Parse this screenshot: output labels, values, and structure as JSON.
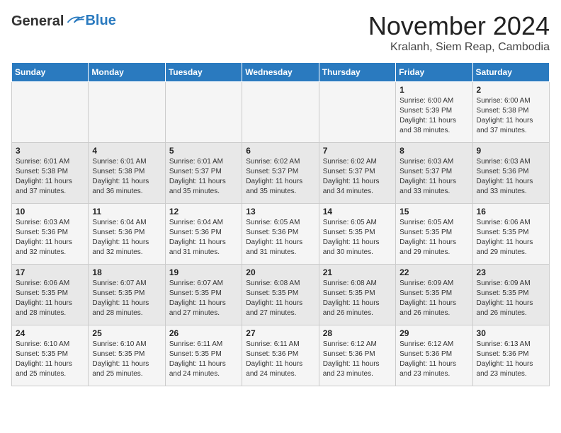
{
  "header": {
    "logo_general": "General",
    "logo_blue": "Blue",
    "month": "November 2024",
    "location": "Kralanh, Siem Reap, Cambodia"
  },
  "weekdays": [
    "Sunday",
    "Monday",
    "Tuesday",
    "Wednesday",
    "Thursday",
    "Friday",
    "Saturday"
  ],
  "weeks": [
    [
      {
        "day": "",
        "info": ""
      },
      {
        "day": "",
        "info": ""
      },
      {
        "day": "",
        "info": ""
      },
      {
        "day": "",
        "info": ""
      },
      {
        "day": "",
        "info": ""
      },
      {
        "day": "1",
        "info": "Sunrise: 6:00 AM\nSunset: 5:39 PM\nDaylight: 11 hours\nand 38 minutes."
      },
      {
        "day": "2",
        "info": "Sunrise: 6:00 AM\nSunset: 5:38 PM\nDaylight: 11 hours\nand 37 minutes."
      }
    ],
    [
      {
        "day": "3",
        "info": "Sunrise: 6:01 AM\nSunset: 5:38 PM\nDaylight: 11 hours\nand 37 minutes."
      },
      {
        "day": "4",
        "info": "Sunrise: 6:01 AM\nSunset: 5:38 PM\nDaylight: 11 hours\nand 36 minutes."
      },
      {
        "day": "5",
        "info": "Sunrise: 6:01 AM\nSunset: 5:37 PM\nDaylight: 11 hours\nand 35 minutes."
      },
      {
        "day": "6",
        "info": "Sunrise: 6:02 AM\nSunset: 5:37 PM\nDaylight: 11 hours\nand 35 minutes."
      },
      {
        "day": "7",
        "info": "Sunrise: 6:02 AM\nSunset: 5:37 PM\nDaylight: 11 hours\nand 34 minutes."
      },
      {
        "day": "8",
        "info": "Sunrise: 6:03 AM\nSunset: 5:37 PM\nDaylight: 11 hours\nand 33 minutes."
      },
      {
        "day": "9",
        "info": "Sunrise: 6:03 AM\nSunset: 5:36 PM\nDaylight: 11 hours\nand 33 minutes."
      }
    ],
    [
      {
        "day": "10",
        "info": "Sunrise: 6:03 AM\nSunset: 5:36 PM\nDaylight: 11 hours\nand 32 minutes."
      },
      {
        "day": "11",
        "info": "Sunrise: 6:04 AM\nSunset: 5:36 PM\nDaylight: 11 hours\nand 32 minutes."
      },
      {
        "day": "12",
        "info": "Sunrise: 6:04 AM\nSunset: 5:36 PM\nDaylight: 11 hours\nand 31 minutes."
      },
      {
        "day": "13",
        "info": "Sunrise: 6:05 AM\nSunset: 5:36 PM\nDaylight: 11 hours\nand 31 minutes."
      },
      {
        "day": "14",
        "info": "Sunrise: 6:05 AM\nSunset: 5:35 PM\nDaylight: 11 hours\nand 30 minutes."
      },
      {
        "day": "15",
        "info": "Sunrise: 6:05 AM\nSunset: 5:35 PM\nDaylight: 11 hours\nand 29 minutes."
      },
      {
        "day": "16",
        "info": "Sunrise: 6:06 AM\nSunset: 5:35 PM\nDaylight: 11 hours\nand 29 minutes."
      }
    ],
    [
      {
        "day": "17",
        "info": "Sunrise: 6:06 AM\nSunset: 5:35 PM\nDaylight: 11 hours\nand 28 minutes."
      },
      {
        "day": "18",
        "info": "Sunrise: 6:07 AM\nSunset: 5:35 PM\nDaylight: 11 hours\nand 28 minutes."
      },
      {
        "day": "19",
        "info": "Sunrise: 6:07 AM\nSunset: 5:35 PM\nDaylight: 11 hours\nand 27 minutes."
      },
      {
        "day": "20",
        "info": "Sunrise: 6:08 AM\nSunset: 5:35 PM\nDaylight: 11 hours\nand 27 minutes."
      },
      {
        "day": "21",
        "info": "Sunrise: 6:08 AM\nSunset: 5:35 PM\nDaylight: 11 hours\nand 26 minutes."
      },
      {
        "day": "22",
        "info": "Sunrise: 6:09 AM\nSunset: 5:35 PM\nDaylight: 11 hours\nand 26 minutes."
      },
      {
        "day": "23",
        "info": "Sunrise: 6:09 AM\nSunset: 5:35 PM\nDaylight: 11 hours\nand 26 minutes."
      }
    ],
    [
      {
        "day": "24",
        "info": "Sunrise: 6:10 AM\nSunset: 5:35 PM\nDaylight: 11 hours\nand 25 minutes."
      },
      {
        "day": "25",
        "info": "Sunrise: 6:10 AM\nSunset: 5:35 PM\nDaylight: 11 hours\nand 25 minutes."
      },
      {
        "day": "26",
        "info": "Sunrise: 6:11 AM\nSunset: 5:35 PM\nDaylight: 11 hours\nand 24 minutes."
      },
      {
        "day": "27",
        "info": "Sunrise: 6:11 AM\nSunset: 5:36 PM\nDaylight: 11 hours\nand 24 minutes."
      },
      {
        "day": "28",
        "info": "Sunrise: 6:12 AM\nSunset: 5:36 PM\nDaylight: 11 hours\nand 23 minutes."
      },
      {
        "day": "29",
        "info": "Sunrise: 6:12 AM\nSunset: 5:36 PM\nDaylight: 11 hours\nand 23 minutes."
      },
      {
        "day": "30",
        "info": "Sunrise: 6:13 AM\nSunset: 5:36 PM\nDaylight: 11 hours\nand 23 minutes."
      }
    ]
  ]
}
